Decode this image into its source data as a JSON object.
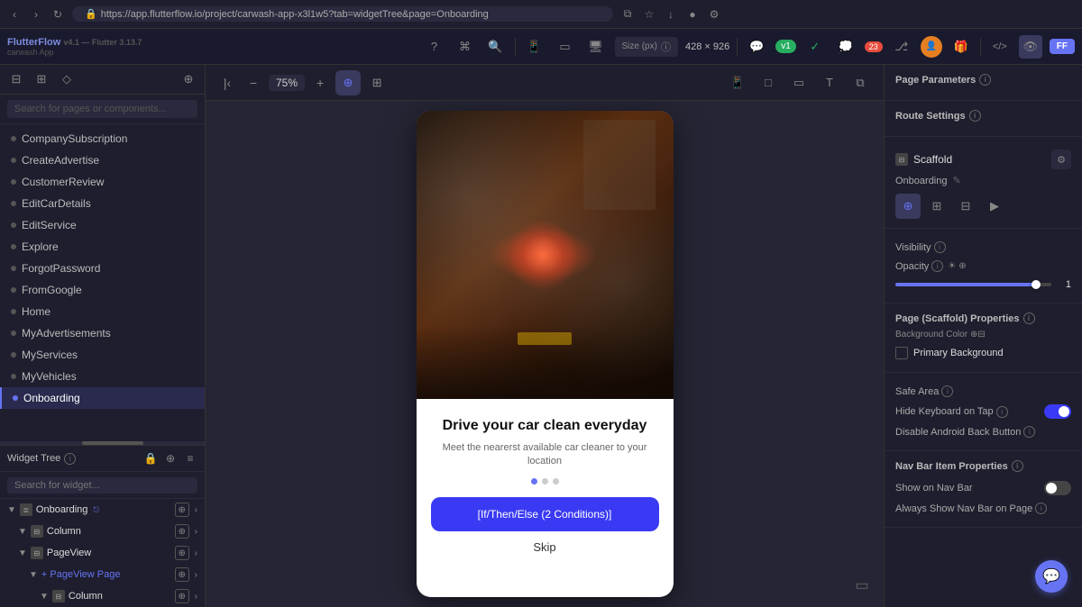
{
  "browser": {
    "url": "https://app.flutterflow.io/project/carwash-app-x3l1w5?tab=widgetTree&page=Onboarding",
    "lock_icon": "🔒"
  },
  "app_header": {
    "brand": "FlutterFlow",
    "version": "v4.1 — Flutter 3.13.7",
    "project": "carwash App"
  },
  "top_header_icons": [
    {
      "name": "help",
      "symbol": "?"
    },
    {
      "name": "shortcut",
      "symbol": "⌘"
    },
    {
      "name": "search",
      "symbol": "🔍"
    },
    {
      "name": "mobile",
      "symbol": "📱"
    },
    {
      "name": "tablet",
      "symbol": "▭"
    },
    {
      "name": "desktop",
      "symbol": "🖥"
    },
    {
      "name": "size",
      "label": "Size (px)"
    },
    {
      "name": "info",
      "symbol": "ⓘ"
    }
  ],
  "canvas_size": "428 × 926",
  "right_header_icons": [
    {
      "name": "comment",
      "symbol": "💬"
    },
    {
      "name": "v1",
      "label": "v1"
    },
    {
      "name": "check",
      "symbol": "✓"
    },
    {
      "name": "chat",
      "symbol": "💭"
    },
    {
      "name": "number23",
      "label": "23"
    },
    {
      "name": "branch",
      "symbol": "⎇"
    },
    {
      "name": "user",
      "symbol": "👤"
    },
    {
      "name": "gift",
      "symbol": "🎁"
    },
    {
      "name": "code",
      "symbol": "</>"
    },
    {
      "name": "eye",
      "symbol": "👁"
    },
    {
      "name": "ff",
      "label": "FF"
    }
  ],
  "sidebar": {
    "search_placeholder": "Search for pages or components...",
    "nav_items": [
      {
        "id": "company-subscription",
        "label": "CompanySubscription"
      },
      {
        "id": "create-advertise",
        "label": "CreateAdvertise"
      },
      {
        "id": "customer-review",
        "label": "CustomerReview"
      },
      {
        "id": "edit-car-details",
        "label": "EditCarDetails"
      },
      {
        "id": "edit-service",
        "label": "EditService"
      },
      {
        "id": "explore",
        "label": "Explore"
      },
      {
        "id": "forgot-password",
        "label": "ForgotPassword"
      },
      {
        "id": "from-google",
        "label": "FromGoogle"
      },
      {
        "id": "home",
        "label": "Home"
      },
      {
        "id": "my-advertisements",
        "label": "MyAdvertisements"
      },
      {
        "id": "my-services",
        "label": "MyServices"
      },
      {
        "id": "my-vehicles",
        "label": "MyVehicles"
      },
      {
        "id": "onboarding",
        "label": "Onboarding",
        "active": true
      }
    ]
  },
  "widget_tree": {
    "label": "Widget Tree",
    "search_placeholder": "Search for widget...",
    "items": [
      {
        "id": "onboarding",
        "label": "Onboarding",
        "icon": "≣",
        "level": 0,
        "has_children": true
      },
      {
        "id": "column",
        "label": "Column",
        "icon": "⊟",
        "level": 1,
        "has_children": true
      },
      {
        "id": "pageview",
        "label": "PageView",
        "icon": "⊟",
        "level": 1,
        "has_children": true
      },
      {
        "id": "pageview-page",
        "label": "+ PageView Page",
        "icon": "+",
        "level": 2,
        "has_children": true
      },
      {
        "id": "column2",
        "label": "Column",
        "icon": "⊟",
        "level": 3,
        "has_children": true
      }
    ]
  },
  "canvas": {
    "zoom": "75%",
    "modes": [
      {
        "id": "select",
        "symbol": "⊕",
        "active": true
      },
      {
        "id": "crop",
        "symbol": "⊞",
        "active": false
      }
    ],
    "viewport_icons": [
      "📱",
      "□",
      "▭",
      "T",
      "⧉"
    ]
  },
  "phone": {
    "title": "Drive your car clean everyday",
    "subtitle": "Meet the  nearerst available car cleaner\nto your location",
    "dots": [
      true,
      false,
      false
    ],
    "cta_label": "[If/Then/Else (2 Conditions)]",
    "skip_label": "Skip"
  },
  "right_panel": {
    "page_parameters_label": "Page Parameters",
    "route_settings_label": "Route Settings",
    "scaffold_label": "Scaffold",
    "page_name": "Onboarding",
    "tabs": [
      {
        "id": "properties",
        "symbol": "⊕",
        "active": true
      },
      {
        "id": "layout",
        "symbol": "⊞"
      },
      {
        "id": "grid",
        "symbol": "⊟"
      },
      {
        "id": "play",
        "symbol": "▶"
      }
    ],
    "visibility_label": "Visibility",
    "opacity_label": "Opacity",
    "opacity_icons": [
      "☀",
      "⊕"
    ],
    "opacity_value": "1",
    "scaffold_properties_label": "Page (Scaffold) Properties",
    "bg_color_label": "Background Color",
    "color_swatch_label": "Primary Background",
    "safe_area_label": "Safe Area",
    "hide_keyboard_label": "Hide Keyboard on Tap",
    "disable_back_label": "Disable Android Back Button",
    "nav_bar_label": "Nav Bar Item Properties",
    "show_nav_bar_label": "Show on Nav Bar",
    "always_show_nav_label": "Always Show Nav Bar on Page"
  }
}
